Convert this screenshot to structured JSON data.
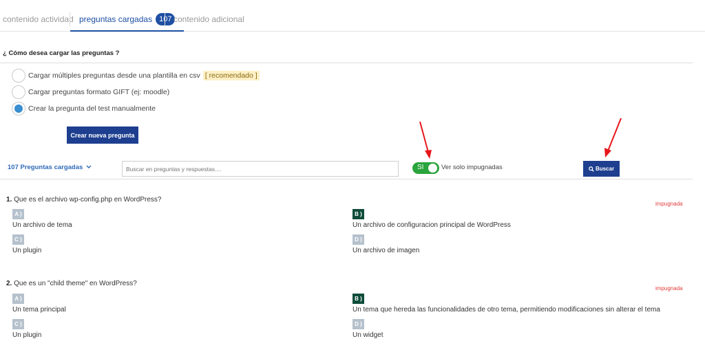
{
  "tabs": {
    "activity": "contenido actividad",
    "questions": "preguntas cargadas",
    "questions_count": "107",
    "additional": "contenido adicional"
  },
  "load_section": {
    "title": "¿ Cómo desea cargar las preguntas ?",
    "options": [
      {
        "label": "Cargar múltiples preguntas desde una plantilla en csv",
        "tag": "[ recomendado ]",
        "checked": false
      },
      {
        "label": "Cargar preguntas formato GIFT (ej: moodle)",
        "checked": false
      },
      {
        "label": "Crear la pregunta del test manualmente",
        "checked": true
      }
    ],
    "create_button": "Crear nueva pregunta"
  },
  "filter_bar": {
    "count_label": "107 Preguntas cargadas",
    "search_placeholder": "Buscar en preguntas y respuestas....",
    "toggle_label": "SI",
    "toggle_on": true,
    "toggle_text": "Ver solo impugnadas",
    "search_button": "Buscar"
  },
  "questions": [
    {
      "number": "1.",
      "text": "Que es el archivo wp-config.php en WordPress?",
      "status": "impugnada",
      "options": [
        {
          "letter": "A )",
          "text": "Un archivo de tema",
          "correct": false
        },
        {
          "letter": "B )",
          "text": "Un archivo de configuracion principal de WordPress",
          "correct": true
        },
        {
          "letter": "C )",
          "text": "Un plugin",
          "correct": false
        },
        {
          "letter": "D )",
          "text": "Un archivo de imagen",
          "correct": false
        }
      ]
    },
    {
      "number": "2.",
      "text": "Que es un \"child theme\" en WordPress?",
      "status": "impugnada",
      "options": [
        {
          "letter": "A )",
          "text": "Un tema principal",
          "correct": false
        },
        {
          "letter": "B )",
          "text": "Un tema que hereda las funcionalidades de otro tema, permitiendo modificaciones sin alterar el tema",
          "correct": true
        },
        {
          "letter": "C )",
          "text": "Un plugin",
          "correct": false
        },
        {
          "letter": "D )",
          "text": "Un widget",
          "correct": false
        }
      ]
    }
  ],
  "colors": {
    "primary": "#1e3f8f",
    "link": "#2f6bb8",
    "toggle": "#2aa43c",
    "impugnada": "#e23b3b",
    "correct_badge": "#0f4d3a",
    "option_badge": "#b5c1cc",
    "annotation_arrow": "#e8161b"
  }
}
